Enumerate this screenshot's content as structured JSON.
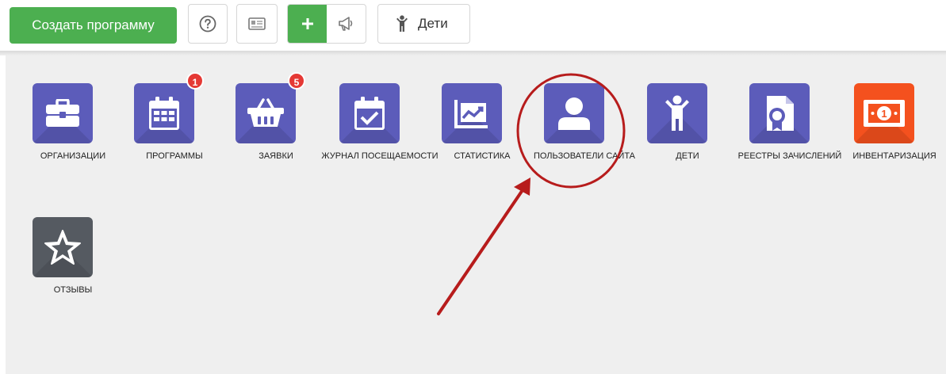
{
  "toolbar": {
    "create_label": "Создать программу",
    "children_label": "Дети",
    "accent": "#4caf50"
  },
  "tiles": [
    {
      "label": "ОРГАНИЗАЦИИ",
      "icon": "briefcase-icon"
    },
    {
      "label": "ПРОГРАММЫ",
      "icon": "calendar-icon",
      "badge": "1"
    },
    {
      "label": "ЗАЯВКИ",
      "icon": "basket-icon",
      "badge": "5"
    },
    {
      "label": "ЖУРНАЛ ПОСЕЩАЕМОСТИ",
      "icon": "calendar-check-icon"
    },
    {
      "label": "СТАТИСТИКА",
      "icon": "chart-icon"
    },
    {
      "label": "ПОЛЬЗОВАТЕЛИ САЙТА",
      "icon": "user-icon"
    },
    {
      "label": "ДЕТИ",
      "icon": "child-icon"
    },
    {
      "label": "РЕЕСТРЫ ЗАЧИСЛЕНИЙ",
      "icon": "certificate-icon"
    },
    {
      "label": "ИНВЕНТАРИЗАЦИЯ",
      "icon": "money-icon"
    },
    {
      "label": "ОТЗЫВЫ",
      "icon": "star-icon"
    }
  ],
  "colors": {
    "tile": "#5c5cba",
    "inventory_tile": "#f4511e",
    "reviews_tile": "#555a61",
    "badge": "#e53935",
    "annotation": "#b71c1c"
  }
}
